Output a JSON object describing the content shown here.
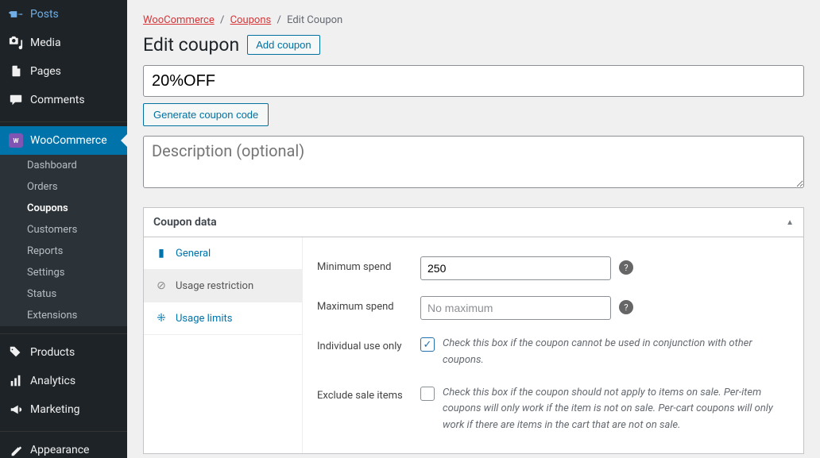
{
  "sidebar": {
    "top": [
      {
        "label": "Posts"
      },
      {
        "label": "Media"
      },
      {
        "label": "Pages"
      },
      {
        "label": "Comments"
      }
    ],
    "woo_label": "WooCommerce",
    "woo_sub": [
      {
        "label": "Dashboard"
      },
      {
        "label": "Orders"
      },
      {
        "label": "Coupons"
      },
      {
        "label": "Customers"
      },
      {
        "label": "Reports"
      },
      {
        "label": "Settings"
      },
      {
        "label": "Status"
      },
      {
        "label": "Extensions"
      }
    ],
    "bottom": [
      {
        "label": "Products"
      },
      {
        "label": "Analytics"
      },
      {
        "label": "Marketing"
      },
      {
        "label": "Appearance"
      }
    ]
  },
  "breadcrumb": {
    "a": "WooCommerce",
    "b": "Coupons",
    "c": "Edit Coupon"
  },
  "heading": "Edit coupon",
  "add_coupon": "Add coupon",
  "coupon_code": "20%OFF",
  "generate_btn": "Generate coupon code",
  "desc_placeholder": "Description (optional)",
  "postbox_title": "Coupon data",
  "tabs": {
    "general": "General",
    "usage_restriction": "Usage restriction",
    "usage_limits": "Usage limits"
  },
  "fields": {
    "min_spend_label": "Minimum spend",
    "min_spend_value": "250",
    "max_spend_label": "Maximum spend",
    "max_spend_placeholder": "No maximum",
    "individual_label": "Individual use only",
    "individual_desc": "Check this box if the coupon cannot be used in conjunction with other coupons.",
    "exclude_label": "Exclude sale items",
    "exclude_desc": "Check this box if the coupon should not apply to items on sale. Per-item coupons will only work if the item is not on sale. Per-cart coupons will only work if there are items in the cart that are not on sale."
  }
}
